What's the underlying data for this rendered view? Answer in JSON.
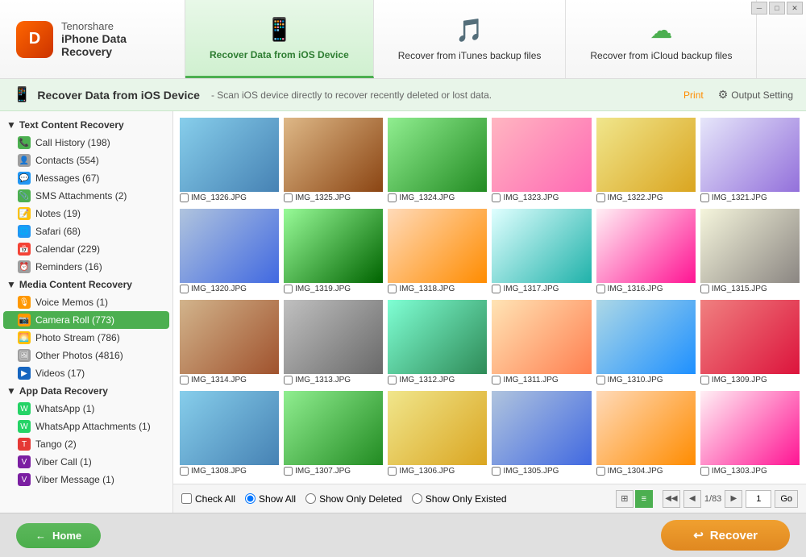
{
  "app": {
    "brand": "Tenorshare",
    "product": "iPhone Data Recovery",
    "logo_letter": "D"
  },
  "header": {
    "tabs": [
      {
        "id": "ios",
        "icon": "📱",
        "label": "Recover Data from iOS Device",
        "active": true
      },
      {
        "id": "itunes",
        "icon": "🎵",
        "label": "Recover from iTunes backup files",
        "active": false
      },
      {
        "id": "icloud",
        "icon": "☁",
        "label": "Recover from iCloud backup files",
        "active": false
      }
    ]
  },
  "toolbar": {
    "title": "Recover Data from iOS Device",
    "description": "- Scan iOS device directly to recover recently deleted or lost data.",
    "print_label": "Print",
    "output_label": "Output Setting"
  },
  "sidebar": {
    "sections": [
      {
        "id": "text",
        "label": "Text Content Recovery",
        "items": [
          {
            "id": "call-history",
            "label": "Call History (198)",
            "icon": "📞",
            "icon_class": "icon-green"
          },
          {
            "id": "contacts",
            "label": "Contacts (554)",
            "icon": "👤",
            "icon_class": "icon-gray"
          },
          {
            "id": "messages",
            "label": "Messages (67)",
            "icon": "💬",
            "icon_class": "icon-blue"
          },
          {
            "id": "sms-attachments",
            "label": "SMS Attachments (2)",
            "icon": "📎",
            "icon_class": "icon-green"
          },
          {
            "id": "notes",
            "label": "Notes (19)",
            "icon": "📝",
            "icon_class": "icon-yellow"
          },
          {
            "id": "safari",
            "label": "Safari (68)",
            "icon": "🌐",
            "icon_class": "icon-blue"
          },
          {
            "id": "calendar",
            "label": "Calendar (229)",
            "icon": "📅",
            "icon_class": "icon-red"
          },
          {
            "id": "reminders",
            "label": "Reminders (16)",
            "icon": "⏰",
            "icon_class": "icon-gray"
          }
        ]
      },
      {
        "id": "media",
        "label": "Media Content Recovery",
        "items": [
          {
            "id": "voice-memos",
            "label": "Voice Memos (1)",
            "icon": "🎙",
            "icon_class": "icon-orange"
          },
          {
            "id": "camera-roll",
            "label": "Camera Roll (773)",
            "icon": "📷",
            "icon_class": "icon-orange",
            "active": true
          },
          {
            "id": "photo-stream",
            "label": "Photo Stream (786)",
            "icon": "🌅",
            "icon_class": "icon-yellow"
          },
          {
            "id": "other-photos",
            "label": "Other Photos (4816)",
            "icon": "🖼",
            "icon_class": "icon-gray"
          },
          {
            "id": "videos",
            "label": "Videos (17)",
            "icon": "▶",
            "icon_class": "icon-darkblue"
          }
        ]
      },
      {
        "id": "app",
        "label": "App Data Recovery",
        "items": [
          {
            "id": "whatsapp",
            "label": "WhatsApp (1)",
            "icon": "W",
            "icon_class": "icon-whatsapp"
          },
          {
            "id": "whatsapp-attachments",
            "label": "WhatsApp Attachments (1)",
            "icon": "W",
            "icon_class": "icon-whatsapp"
          },
          {
            "id": "tango",
            "label": "Tango (2)",
            "icon": "T",
            "icon_class": "icon-tango"
          },
          {
            "id": "viber-call",
            "label": "Viber Call (1)",
            "icon": "V",
            "icon_class": "icon-viber"
          },
          {
            "id": "viber-message",
            "label": "Viber Message (1)",
            "icon": "V",
            "icon_class": "icon-viber"
          }
        ]
      }
    ]
  },
  "photos": [
    {
      "id": "1326",
      "name": "IMG_1326.JPG",
      "ph": "ph1"
    },
    {
      "id": "1325",
      "name": "IMG_1325.JPG",
      "ph": "ph2"
    },
    {
      "id": "1324",
      "name": "IMG_1324.JPG",
      "ph": "ph3"
    },
    {
      "id": "1323",
      "name": "IMG_1323.JPG",
      "ph": "ph4"
    },
    {
      "id": "1322",
      "name": "IMG_1322.JPG",
      "ph": "ph5"
    },
    {
      "id": "1321",
      "name": "IMG_1321.JPG",
      "ph": "ph6"
    },
    {
      "id": "1320",
      "name": "IMG_1320.JPG",
      "ph": "ph7"
    },
    {
      "id": "1319",
      "name": "IMG_1319.JPG",
      "ph": "ph8"
    },
    {
      "id": "1318",
      "name": "IMG_1318.JPG",
      "ph": "ph9"
    },
    {
      "id": "1317",
      "name": "IMG_1317.JPG",
      "ph": "ph10"
    },
    {
      "id": "1316",
      "name": "IMG_1316.JPG",
      "ph": "ph11"
    },
    {
      "id": "1315",
      "name": "IMG_1315.JPG",
      "ph": "ph12"
    },
    {
      "id": "1314",
      "name": "IMG_1314.JPG",
      "ph": "ph13"
    },
    {
      "id": "1313",
      "name": "IMG_1313.JPG",
      "ph": "ph14"
    },
    {
      "id": "1312",
      "name": "IMG_1312.JPG",
      "ph": "ph15"
    },
    {
      "id": "1311",
      "name": "IMG_1311.JPG",
      "ph": "ph16"
    },
    {
      "id": "1310",
      "name": "IMG_1310.JPG",
      "ph": "ph17"
    },
    {
      "id": "1309",
      "name": "IMG_1309.JPG",
      "ph": "ph18"
    },
    {
      "id": "1308",
      "name": "IMG_1308.JPG",
      "ph": "ph1"
    },
    {
      "id": "1307",
      "name": "IMG_1307.JPG",
      "ph": "ph3"
    },
    {
      "id": "1306",
      "name": "IMG_1306.JPG",
      "ph": "ph5"
    },
    {
      "id": "1305",
      "name": "IMG_1305.JPG",
      "ph": "ph7"
    },
    {
      "id": "1304",
      "name": "IMG_1304.JPG",
      "ph": "ph9"
    },
    {
      "id": "1303",
      "name": "IMG_1303.JPG",
      "ph": "ph11"
    }
  ],
  "bottom": {
    "check_all": "Check All",
    "show_all": "Show All",
    "show_deleted": "Show Only Deleted",
    "show_existed": "Show Only Existed",
    "page_info": "1/83",
    "page_num": "1",
    "go_label": "Go"
  },
  "footer": {
    "home_label": "Home",
    "recover_label": "Recover"
  }
}
